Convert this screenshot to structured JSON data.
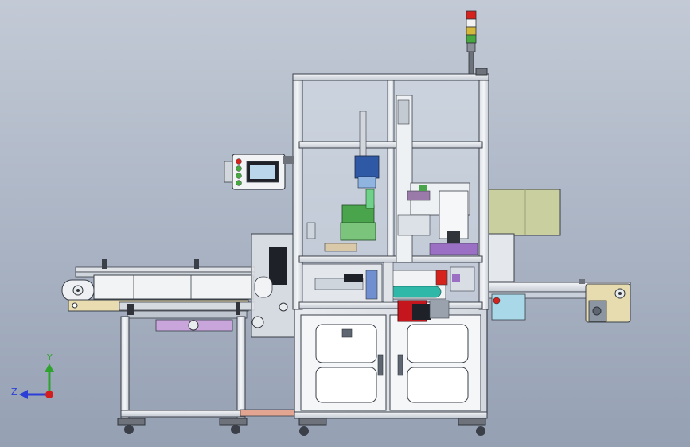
{
  "viewport": {
    "colors": {
      "frame": "#e6e9ee",
      "frame_edge": "#3a3f48",
      "panel_green": "#c9cf9f",
      "guard_blue": "#9fb3cf",
      "motor_red": "#c4161c",
      "roller_teal": "#2fb7a8",
      "conveyor_purple": "#9b6fc4",
      "light_red": "#d6221c",
      "light_yellow": "#d3b83a",
      "light_green": "#46a83e"
    }
  },
  "triad": {
    "y_label": "Y",
    "z_label": "Z",
    "y_color": "#2ea32e",
    "z_color": "#2b3fd6",
    "x_color": "#d41e1e"
  }
}
